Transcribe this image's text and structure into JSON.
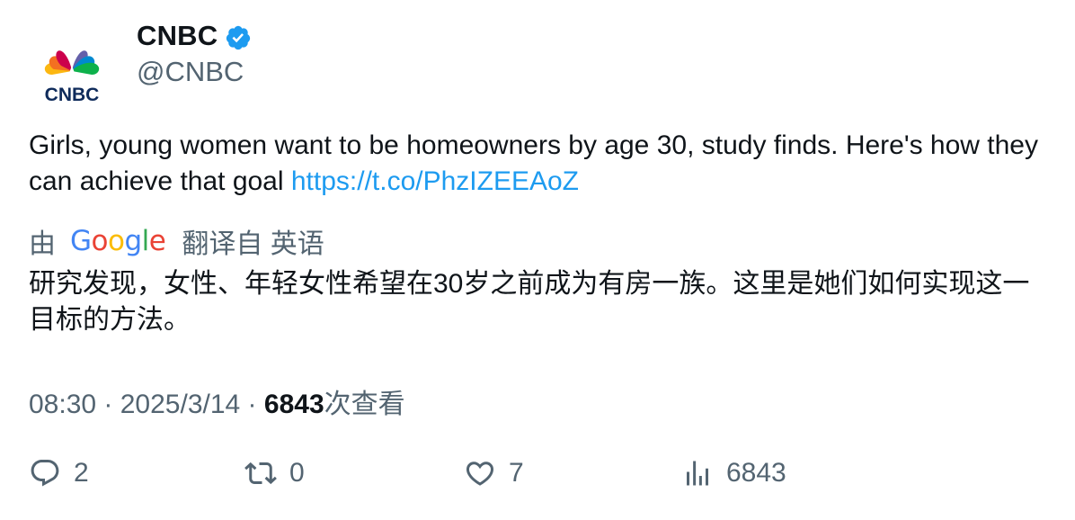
{
  "author": {
    "name": "CNBC",
    "handle": "@CNBC",
    "avatar_logo_text": "CNBC",
    "verified": true,
    "verified_color": "#1d9bf0"
  },
  "tweet": {
    "text": "Girls, young women want to be homeowners by age 30, study finds. Here's how they can achieve that goal ",
    "link": "https://t.co/PhzIZEEAoZ",
    "link_color": "#1d9bf0"
  },
  "translation": {
    "by_label": "由",
    "provider": "Google",
    "translated_from_label": "翻译自 英语",
    "text": "研究发现，女性、年轻女性希望在30岁之前成为有房一族。这里是她们如何实现这一目标的方法。"
  },
  "meta": {
    "time": "08:30",
    "separator": " · ",
    "date": "2025/3/14",
    "views_count": "6843",
    "views_label": "次查看"
  },
  "actions": {
    "reply": {
      "icon": "reply-icon",
      "count": "2"
    },
    "retweet": {
      "icon": "retweet-icon",
      "count": "0"
    },
    "like": {
      "icon": "heart-icon",
      "count": "7"
    },
    "views": {
      "icon": "analytics-icon",
      "count": "6843"
    }
  }
}
